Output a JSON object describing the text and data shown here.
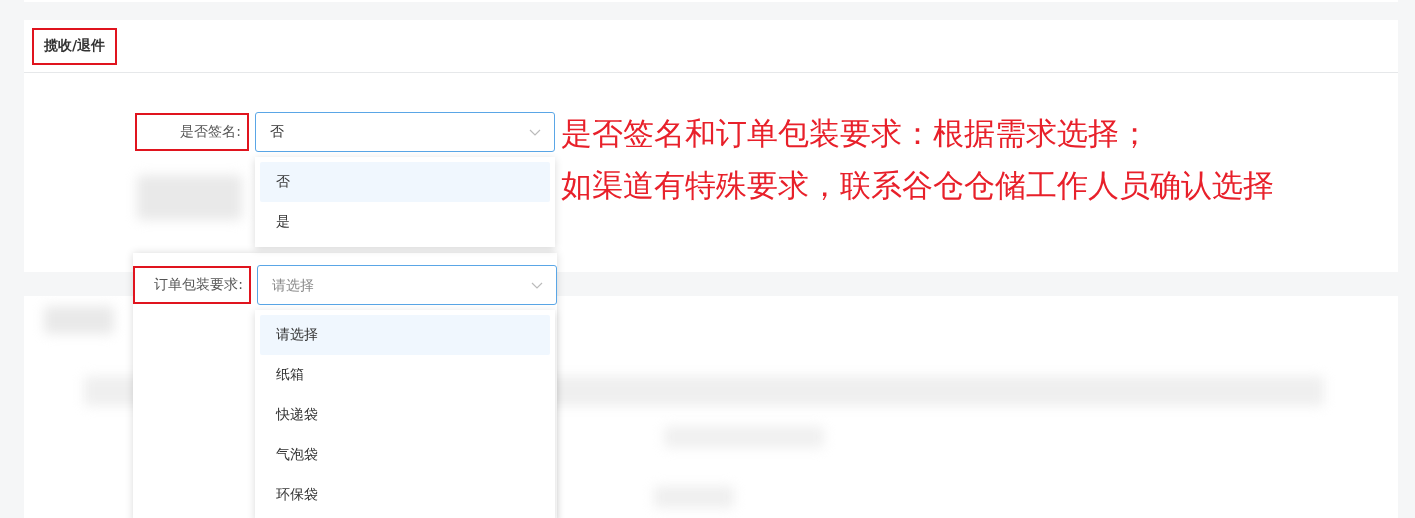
{
  "section": {
    "title": "揽收/退件",
    "highlighted": true
  },
  "fields": [
    {
      "label": "是否签名:",
      "highlighted": true,
      "value": "否",
      "options": [
        {
          "label": "否",
          "selected": true
        },
        {
          "label": "是",
          "selected": false
        }
      ]
    },
    {
      "label": "订单包装要求:",
      "highlighted": true,
      "placeholder": "请选择",
      "options": [
        {
          "label": "请选择",
          "selected": true
        },
        {
          "label": "纸箱",
          "selected": false
        },
        {
          "label": "快递袋",
          "selected": false
        },
        {
          "label": "气泡袋",
          "selected": false
        },
        {
          "label": "环保袋",
          "selected": false
        }
      ]
    }
  ],
  "annotation": [
    "是否签名和订单包装要求：根据需求选择；",
    "如渠道有特殊要求，联系谷仓仓储工作人员确认选择"
  ]
}
